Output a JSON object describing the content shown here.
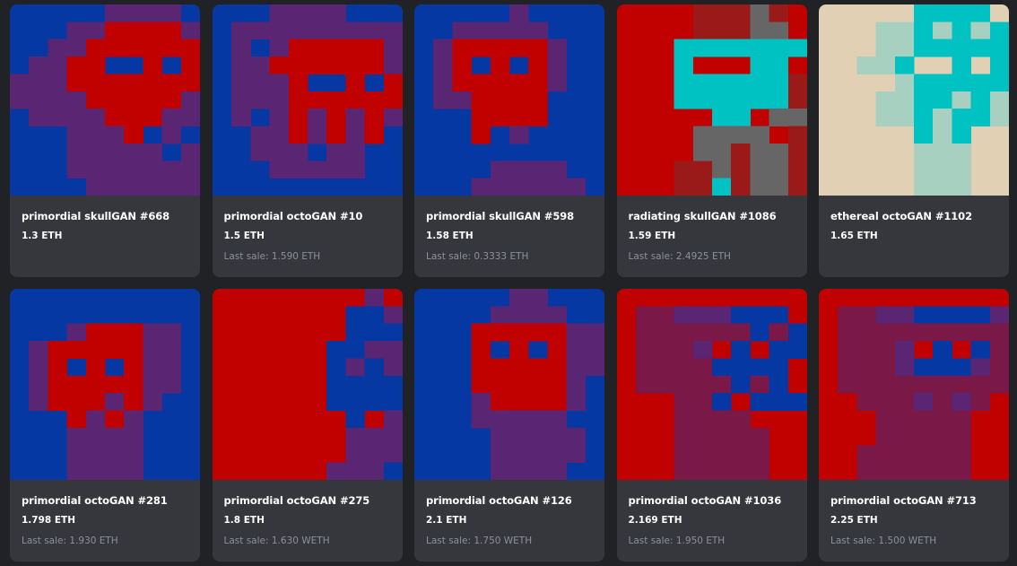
{
  "cards": [
    {
      "name": "primordial skullGAN #668",
      "price": "1.3 ETH",
      "last_sale": "",
      "palette": [
        "#0638a3",
        "#5a2572",
        "#c10000"
      ],
      "grid": [
        "0000011110",
        "0001122221",
        "0011222222",
        "0112200202",
        "1112222222",
        "1111222221",
        "0111122211",
        "0001112010",
        "0001111101",
        "0001111111",
        "0000111111"
      ]
    },
    {
      "name": "primordial octoGAN #10",
      "price": "1.5 ETH",
      "last_sale": "Last sale: 1.590 ETH",
      "palette": [
        "#0638a3",
        "#5a2572",
        "#c10000"
      ],
      "grid": [
        "0001111000",
        "0111111111",
        "0101222221",
        "0112222221",
        "0111200202",
        "0111222222",
        "0101212121",
        "0011212120",
        "0011101100",
        "0001111100",
        "0000000000"
      ]
    },
    {
      "name": "primordial skullGAN #598",
      "price": "1.58 ETH",
      "last_sale": "Last sale: 0.3333 ETH",
      "palette": [
        "#0638a3",
        "#5a2572",
        "#c10000"
      ],
      "grid": [
        "0000010000",
        "0011111000",
        "0122222100",
        "0120202100",
        "0122222100",
        "0112222000",
        "0002222000",
        "0002010000",
        "0000000000",
        "0000111100",
        "0001111110"
      ]
    },
    {
      "name": "radiating skullGAN #1086",
      "price": "1.59 ETH",
      "last_sale": "Last sale: 2.4925 ETH",
      "palette": [
        "#c10000",
        "#00c2c2",
        "#666666",
        "#9a1a1a"
      ],
      "grid": [
        "0000333230",
        "0000333220",
        "0001111111",
        "0001000110",
        "0001111113",
        "0001111113",
        "0000011022",
        "0000222203",
        "0000223223",
        "0003323223",
        "0003313223"
      ]
    },
    {
      "name": "ethereal octoGAN #1102",
      "price": "1.65 ETH",
      "last_sale": "",
      "palette": [
        "#e2d0b4",
        "#00c2c2",
        "#a7d0c1",
        "#d6dbc8"
      ],
      "grid": [
        "0000011110",
        "0002212121",
        "0002211111",
        "0022100101",
        "0000211111",
        "0002211212",
        "0002212112",
        "0000012100",
        "0000022200",
        "0000022200",
        "0000022200"
      ]
    },
    {
      "name": "primordial octoGAN #281",
      "price": "1.798 ETH",
      "last_sale": "Last sale: 1.930 ETH",
      "palette": [
        "#0638a3",
        "#5a2572",
        "#c10000"
      ],
      "grid": [
        "0000000000",
        "0000000000",
        "0001222110",
        "0122222110",
        "0120202110",
        "0122222110",
        "0122212100",
        "0002121000",
        "0001111000",
        "0001111000",
        "0001111000"
      ]
    },
    {
      "name": "primordial octoGAN #275",
      "price": "1.8 ETH",
      "last_sale": "Last sale: 1.630 WETH",
      "palette": [
        "#c10000",
        "#0638a3",
        "#5a2572"
      ],
      "grid": [
        "0000000020",
        "0000000112",
        "0000000111",
        "0000001122",
        "0000001212",
        "0000001111",
        "0000001111",
        "0000000102",
        "0000000222",
        "0000000222",
        "0000002221"
      ]
    },
    {
      "name": "primordial octoGAN #126",
      "price": "2.1 ETH",
      "last_sale": "Last sale: 1.750 WETH",
      "palette": [
        "#0638a3",
        "#5a2572",
        "#c10000"
      ],
      "grid": [
        "0000011000",
        "0000111100",
        "0002222211",
        "0002020211",
        "0002222211",
        "0002222210",
        "0001222210",
        "0001111100",
        "0000111110",
        "0000111110",
        "0000111100"
      ]
    },
    {
      "name": "primordial octoGAN #1036",
      "price": "2.169 ETH",
      "last_sale": "Last sale: 1.950 ETH",
      "palette": [
        "#c10000",
        "#0638a3",
        "#7a1848",
        "#5a2572"
      ],
      "grid": [
        "0000000000",
        "0223331110",
        "0222222121",
        "0222301011",
        "0222211110",
        "0222221210",
        "0002210111",
        "0002222000",
        "0002222200",
        "0002222200",
        "0002222200"
      ]
    },
    {
      "name": "primordial octoGAN #713",
      "price": "2.25 ETH",
      "last_sale": "Last sale: 1.500 WETH",
      "palette": [
        "#c10000",
        "#0638a3",
        "#7a1848",
        "#5a2572"
      ],
      "grid": [
        "0000000000",
        "0223311113",
        "0222222222",
        "0222301012",
        "0222311132",
        "0222222222",
        "0022232320",
        "0002222200",
        "0002222200",
        "0022222200",
        "0022222200"
      ]
    }
  ]
}
